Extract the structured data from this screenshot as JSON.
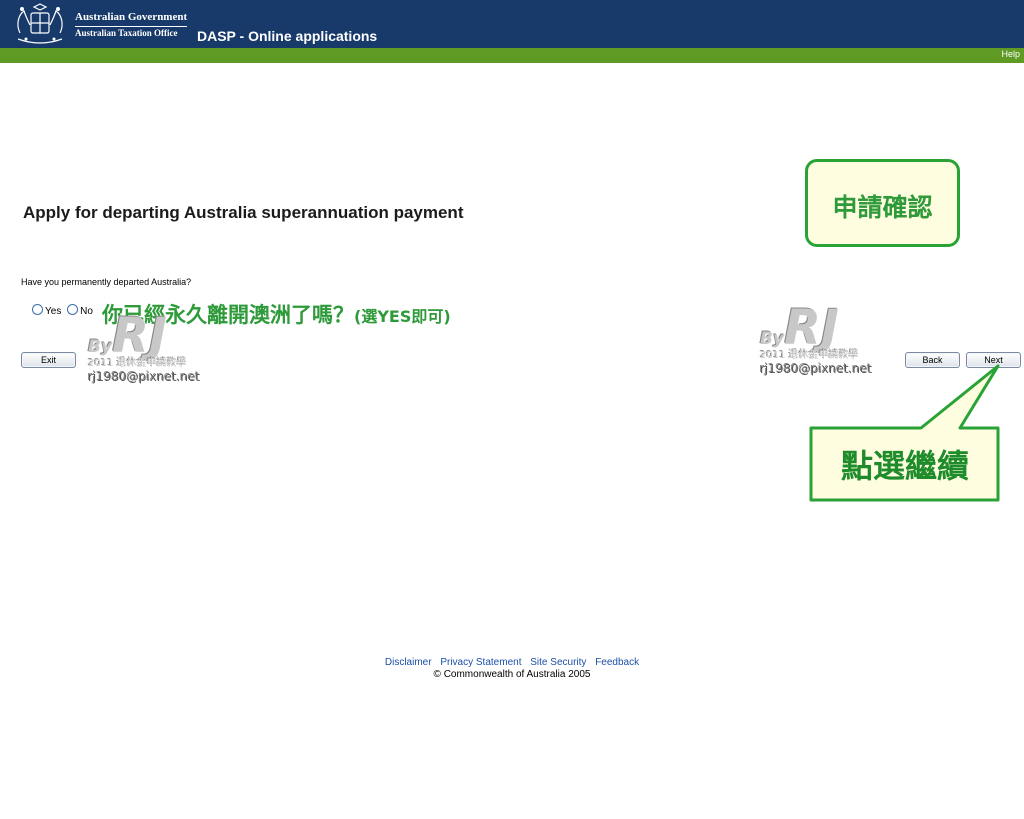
{
  "header": {
    "gov_name": "Australian Government",
    "agency_name": "Australian Taxation Office",
    "app_title": "DASP - Online applications"
  },
  "nav": {
    "help_label": "Help"
  },
  "main": {
    "heading": "Apply for departing Australia superannuation payment",
    "question": "Have you permanently departed Australia?",
    "options": [
      {
        "label": "Yes",
        "selected": false
      },
      {
        "label": "No",
        "selected": false
      }
    ],
    "exit_label": "Exit",
    "back_label": "Back",
    "next_label": "Next"
  },
  "annotations": {
    "confirm_label": "申請確認",
    "question_note": "你已經永久離開澳洲了嗎？",
    "question_hint": "(選YES即可)",
    "next_note": "點選繼續"
  },
  "watermark": {
    "brand": "RJ",
    "by": "By",
    "subtitle": "2011 退休金申請教學",
    "email": "rj1980@pixnet.net"
  },
  "footer": {
    "links": [
      "Disclaimer",
      "Privacy Statement",
      "Site Security",
      "Feedback"
    ],
    "copyright": "© Commonwealth of Australia 2005"
  },
  "colors": {
    "header_bg": "#173a6b",
    "accent_green": "#5f9a25",
    "annotation_green": "#2e9a3a",
    "link_blue": "#1b4fa8"
  }
}
